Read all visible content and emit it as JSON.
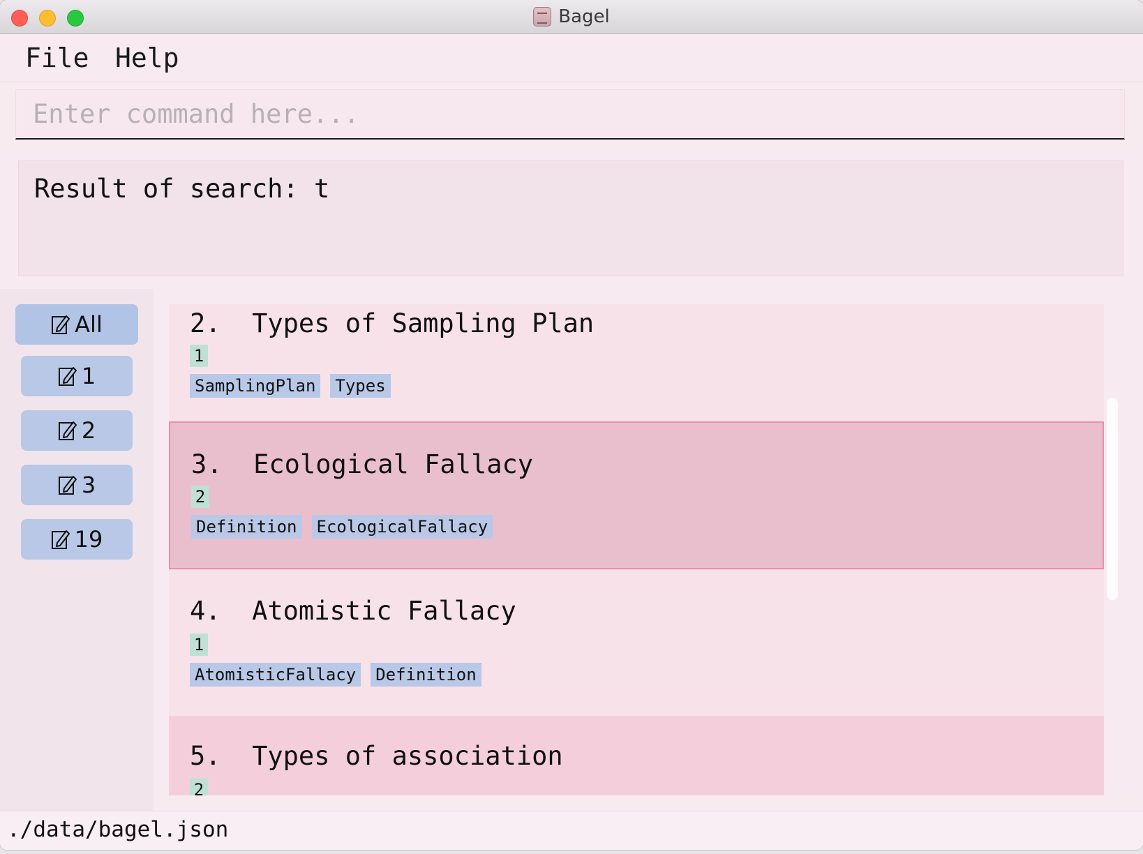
{
  "window": {
    "title": "Bagel",
    "app_icon": "notebook-icon"
  },
  "menu": {
    "file": "File",
    "help": "Help"
  },
  "command": {
    "placeholder": "Enter command here...",
    "value": ""
  },
  "result": {
    "text": "Result of search: t"
  },
  "sidebar": {
    "all_label": "All",
    "icon": "edit-note-icon",
    "items": [
      {
        "label": "1"
      },
      {
        "label": "2"
      },
      {
        "label": "3"
      },
      {
        "label": "19"
      }
    ]
  },
  "cards": [
    {
      "title": "2.  Types of Sampling Plan",
      "badge": "1",
      "tags": [
        "SamplingPlan",
        "Types"
      ],
      "selected": false
    },
    {
      "title": "3.  Ecological Fallacy",
      "badge": "2",
      "tags": [
        "Definition",
        "EcologicalFallacy"
      ],
      "selected": true
    },
    {
      "title": "4.  Atomistic Fallacy",
      "badge": "1",
      "tags": [
        "AtomisticFallacy",
        "Definition"
      ],
      "selected": false
    },
    {
      "title": "5.  Types of association",
      "badge": "2",
      "tags": [],
      "selected": false
    }
  ],
  "status": {
    "path": "./data/bagel.json"
  },
  "colors": {
    "background": "#f7eaf0",
    "tag": "#b8c8e6",
    "badge": "#bfe0d4",
    "selected": "#eabfcd",
    "selected_border": "#ea8fab"
  }
}
